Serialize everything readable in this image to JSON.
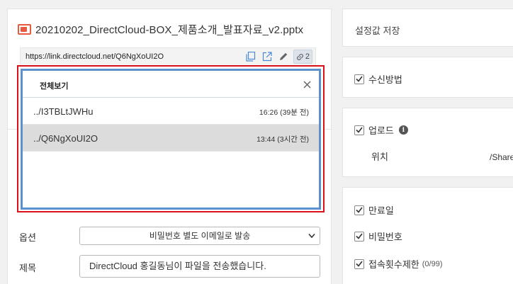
{
  "file": {
    "name": "20210202_DirectCloud-BOX_제품소개_발표자료_v2.pptx",
    "link_url": "https://link.directcloud.net/Q6NgXoUI2O",
    "share_count": "2",
    "tools": [
      "copy-icon",
      "open-external-icon",
      "edit-pencil-icon",
      "link-icon"
    ]
  },
  "popup": {
    "title": "전체보기",
    "items": [
      {
        "link": "../I3TBLtJWHu",
        "time": "16:26 (39분 전)"
      },
      {
        "link": "../Q6NgXoUI2O",
        "time": "13:44 (3시간 전)"
      }
    ]
  },
  "form": {
    "option_label": "옵션",
    "option_value": "비밀번호 별도 이메일로 발송",
    "subject_label": "제목",
    "subject_value": "DirectCloud 홍길동님이 파일을 전송했습니다."
  },
  "settings": {
    "save_label": "설정값 저장",
    "receive_method": "수신방법",
    "upload": "업로드",
    "location_label": "위치",
    "location_value": "/Share",
    "expiry": "만료일",
    "password": "비밀번호",
    "access_limit": "접속횟수제한",
    "access_limit_count": "(0/99)"
  },
  "colors": {
    "highlight_red": "#d9111b",
    "popup_blue": "#5b91cf",
    "file_icon_orange": "#e8593f"
  }
}
